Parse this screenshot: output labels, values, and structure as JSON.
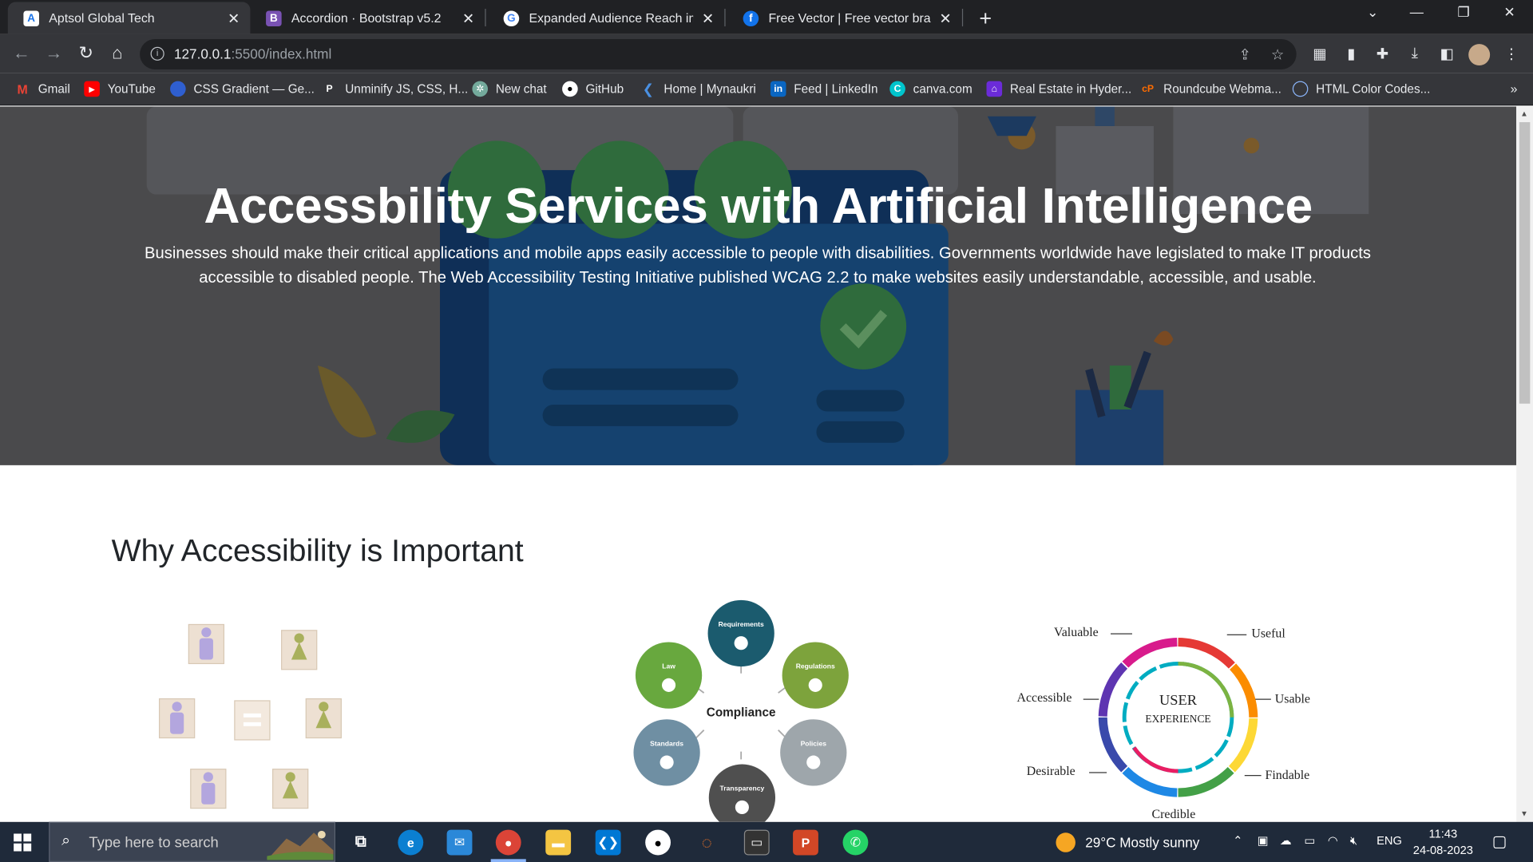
{
  "browser": {
    "tabs": [
      {
        "title": "Aptsol Global Tech",
        "active": true
      },
      {
        "title": "Accordion · Bootstrap v5.2",
        "active": false
      },
      {
        "title": "Expanded Audience Reach image",
        "active": false
      },
      {
        "title": "Free Vector | Free vector brand a",
        "active": false
      }
    ],
    "url_host": "127.0.0.1",
    "url_path": ":5500/index.html",
    "bookmarks": [
      "Gmail",
      "YouTube",
      "CSS Gradient — Ge...",
      "Unminify JS, CSS, H...",
      "New chat",
      "GitHub",
      "Home | Mynaukri",
      "Feed | LinkedIn",
      "canva.com",
      "Real Estate in Hyder...",
      "Roundcube Webma...",
      "HTML Color Codes..."
    ]
  },
  "hero": {
    "title": "Accessbility Services with Artificial Intelligence",
    "text": "Businesses should make their critical applications and mobile apps easily accessible to people with disabilities. Governments worldwide have legislated to make IT products accessible to disabled people. The Web Accessibility Testing Initiative published WCAG 2.2 to make websites easily understandable, accessible, and usable."
  },
  "why": {
    "title": "Why Accessibility is Important"
  },
  "compliance": {
    "center": "Compliance",
    "nodes": [
      "Requirements",
      "Regulations",
      "Policies",
      "Transparency",
      "Standards",
      "Law"
    ]
  },
  "ux_wheel": {
    "center_line1": "USER",
    "center_line2": "EXPERIENCE",
    "labels": [
      "Valuable",
      "Useful",
      "Accessible",
      "Usable",
      "Desirable",
      "Findable",
      "Credible"
    ]
  },
  "taskbar": {
    "search_placeholder": "Type here to search",
    "weather": "29°C  Mostly sunny",
    "language": "ENG",
    "time": "11:43",
    "date": "24-08-2023"
  },
  "colors": {
    "hero_bg": "#4a4a4c",
    "chrome_dark": "#202124",
    "chrome_toolbar": "#35363a",
    "taskbar": "#1f2a3a"
  }
}
